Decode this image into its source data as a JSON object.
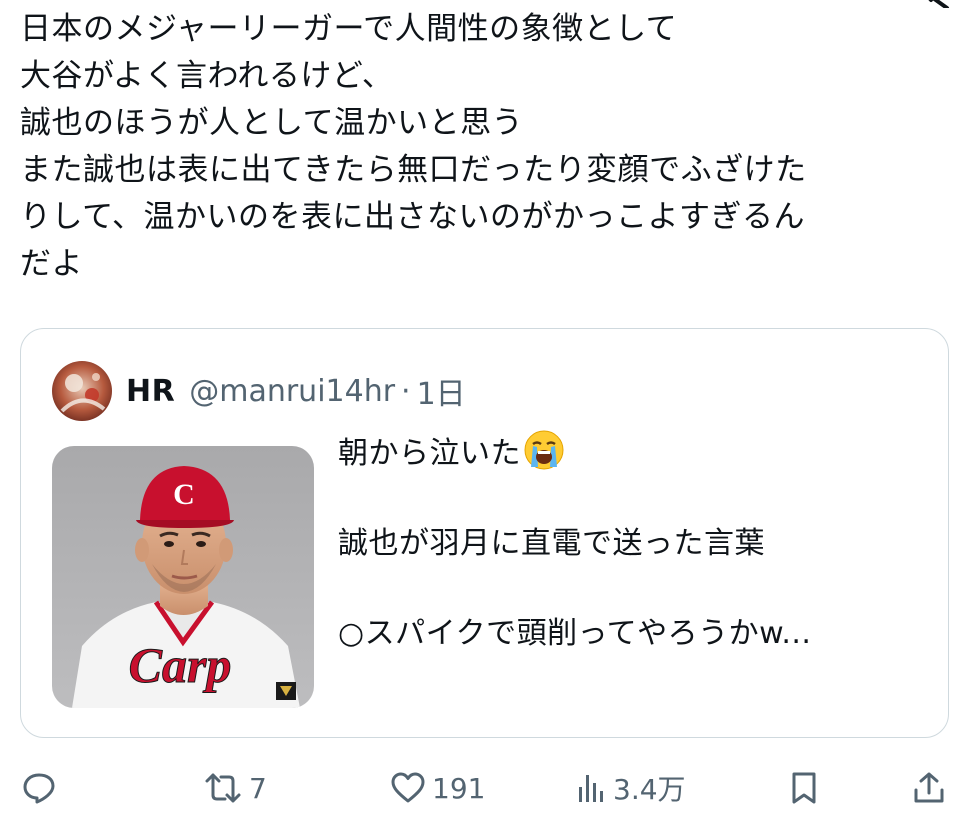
{
  "tweet": {
    "text_lines": [
      "日本のメジャーリーガーで人間性の象徴として",
      "大谷がよく言われるけど、",
      "誠也のほうが人として温かいと思う",
      "また誠也は表に出てきたら無口だったり変顔でふざけた",
      "りして、温かいのを表に出さないのがかっこよすぎるん",
      "だよ"
    ]
  },
  "quote": {
    "display_name": "HR",
    "handle": "@manrui14hr",
    "separator": "·",
    "time": "1日",
    "body_lines": [
      "朝から泣いた",
      "",
      "誠也が羽月に直電で送った言葉",
      "",
      "○スパイクで頭削ってやろうかw..."
    ],
    "emoji": "loudly-crying-face",
    "photo": "player-portrait"
  },
  "actions": {
    "reply_count": "",
    "retweet_count": "7",
    "like_count": "191",
    "view_count": "3.4万"
  },
  "colors": {
    "text": "#0f1419",
    "muted": "#536471",
    "border": "#cfd9de",
    "cap_red": "#c8102e"
  }
}
